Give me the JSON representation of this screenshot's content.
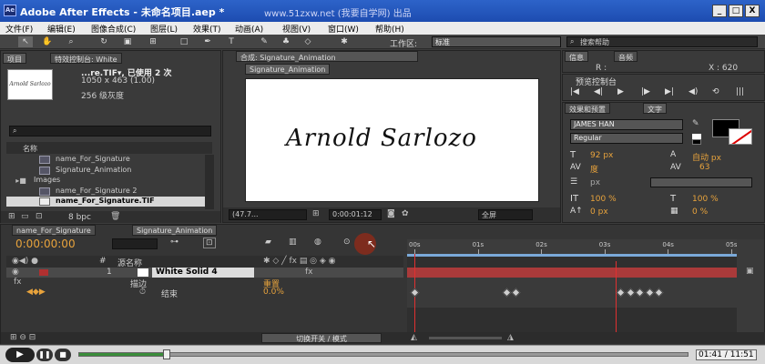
{
  "window": {
    "title": "Adobe After Effects - 未命名项目.aep *",
    "watermark": "www.51zxw.net (我要自学网) 出品",
    "app_icon": "Ae",
    "minimize": "_",
    "restore": "□",
    "close": "X"
  },
  "menu": [
    "文件(F)",
    "编辑(E)",
    "图像合成(C)",
    "图层(L)",
    "效果(T)",
    "动画(A)",
    "视图(V)",
    "窗口(W)",
    "帮助(H)"
  ],
  "toolbar": {
    "workspace_label": "工作区:",
    "workspace_value": "标准",
    "search_help": "搜索帮助"
  },
  "project": {
    "tab_project": "项目",
    "tab_effects": "特效控制台: White",
    "item_name": "...re.TIF▾, 已使用 2 次",
    "item_size": "1050 x 463 (1.00)",
    "item_color": "256 级灰度",
    "thumb_text": "Arnold Sarlozo",
    "search_icon_char": "⌕",
    "col_name": "名称",
    "items": [
      {
        "label": "name_For_Signature",
        "indent": 1,
        "type": "comp"
      },
      {
        "label": "Signature_Animation",
        "indent": 1,
        "type": "comp"
      },
      {
        "label": "Images",
        "indent": 0,
        "type": "folder"
      },
      {
        "label": "name_For_Signature 2",
        "indent": 1,
        "type": "comp"
      },
      {
        "label": "name_For_Signature.TIF",
        "indent": 1,
        "type": "file"
      }
    ],
    "bpc": "8 bpc"
  },
  "composition": {
    "tab_label": "合成: Signature_Animation",
    "subtab": "Signature_Animation",
    "signature_text": "Arnold Sarlozo",
    "zoom": "(47.7...",
    "timecode": "0:00:01:12",
    "view_mode": "全屏"
  },
  "info": {
    "tab_info": "信息",
    "tab_audio": "音频",
    "r_label": "R :",
    "x_label": "X : 620"
  },
  "preview": {
    "title": "预览控制台",
    "buttons": [
      "|◀",
      "◀|",
      "▶",
      "|▶",
      "▶|",
      "◀)",
      "⟲",
      "|||"
    ]
  },
  "character": {
    "tab_effects": "效果和预置",
    "tab_text": "文字",
    "font": "JAMES HAN",
    "style": "Regular",
    "size": "92",
    "size_unit": "px",
    "leading": "自动",
    "leading_unit": "px",
    "kerning": "度",
    "tracking": "63",
    "stroke_unit": "px",
    "vscale": "100",
    "hscale": "100",
    "baseline": "0",
    "baseline_unit": "px",
    "tsume": "0",
    "pct": "%"
  },
  "timeline": {
    "tab1": "name_For_Signature",
    "tab2": "Signature_Animation",
    "timecode": "0:00:00:00",
    "col_num": "#",
    "col_source": "源名称",
    "layer_num": "1",
    "layer_name": "White Solid 4",
    "effect_label": "fx",
    "effect_name": "描边",
    "reset": "重置",
    "prop_name": "结束",
    "prop_value": "0.0%",
    "switch_mode": "切换开关 / 模式",
    "ruler": [
      "00s",
      "01s",
      "02s",
      "03s",
      "04s",
      "05s"
    ],
    "keyframes": [
      1.45,
      1.6,
      3.25,
      3.4,
      3.55,
      3.7,
      3.85
    ]
  },
  "player": {
    "time": "01:41 / 11:51",
    "progress": 0.143
  }
}
